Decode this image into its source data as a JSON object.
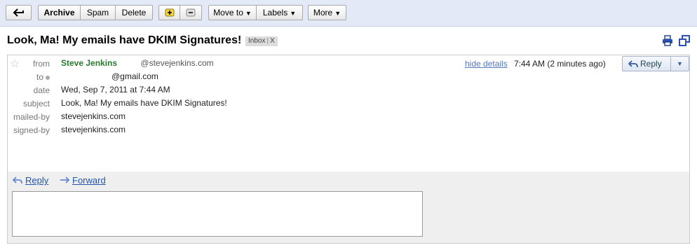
{
  "toolbar": {
    "archive_label": "Archive",
    "spam_label": "Spam",
    "delete_label": "Delete",
    "move_to_label": "Move to",
    "labels_label": "Labels",
    "more_label": "More"
  },
  "subject": {
    "title": "Look, Ma! My emails have DKIM Signatures!",
    "label_chip": "Inbox",
    "label_remove": "X"
  },
  "message": {
    "from_label": "from",
    "sender_name": "Steve Jenkins",
    "sender_email_domain": "@stevejenkins.com",
    "to_label": "to",
    "to_value": "@gmail.com",
    "date_label": "date",
    "date_value": "Wed, Sep 7, 2011 at 7:44 AM",
    "subject_label": "subject",
    "subject_value": "Look, Ma! My emails have DKIM Signatures!",
    "mailed_by_label": "mailed-by",
    "mailed_by_value": "stevejenkins.com",
    "signed_by_label": "signed-by",
    "signed_by_value": "stevejenkins.com",
    "hide_details": "hide details",
    "time": "7:44 AM (2 minutes ago)",
    "reply_label": "Reply"
  },
  "footer": {
    "reply_link": "Reply",
    "forward_link": "Forward"
  },
  "colors": {
    "toolbar_bg": "#e4e9f7",
    "sender_green": "#297a2d",
    "link_blue": "#2255aa"
  }
}
